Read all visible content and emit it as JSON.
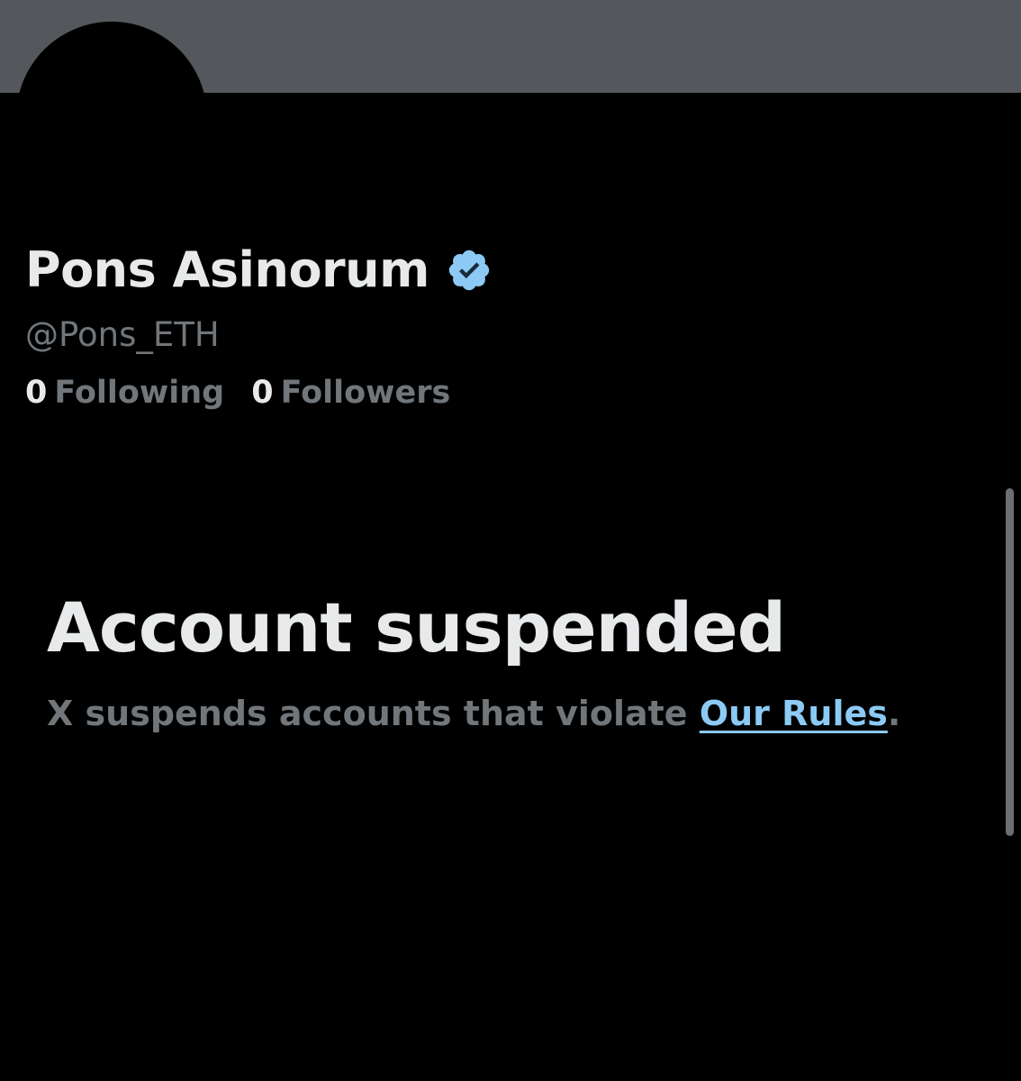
{
  "profile": {
    "display_name": "Pons Asinorum",
    "verified_icon": "verified-badge-icon",
    "handle": "@Pons_ETH",
    "following_count": "0",
    "following_label": "Following",
    "followers_count": "0",
    "followers_label": "Followers"
  },
  "suspension": {
    "title": "Account suspended",
    "message_prefix": "X suspends accounts that violate ",
    "rules_link": "Our Rules",
    "message_suffix": "."
  },
  "colors": {
    "banner": "#54575b",
    "background": "#000000",
    "primary_text": "#e7e9ea",
    "secondary_text": "#71767b",
    "link": "#8ccaf5",
    "verified_badge": "#1d9bf0"
  }
}
